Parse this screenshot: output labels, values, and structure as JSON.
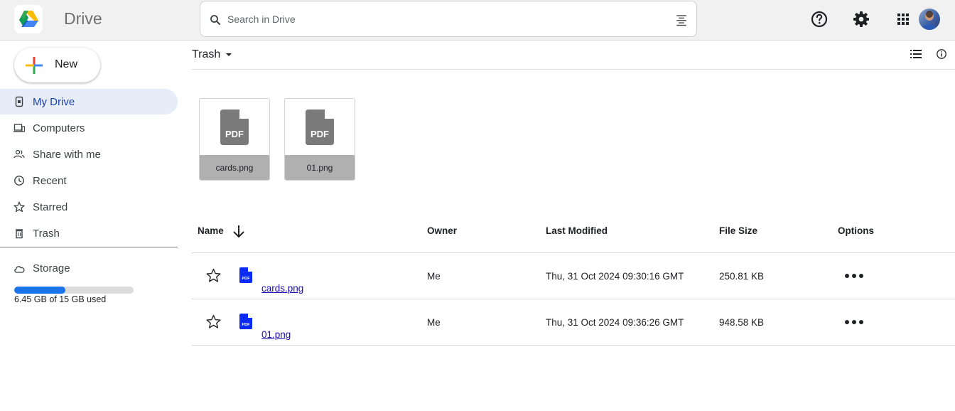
{
  "header": {
    "app_title": "Drive",
    "search_placeholder": "Search in Drive",
    "icons": [
      "drive-logo-icon",
      "search-icon",
      "filter-options-icon",
      "help-icon",
      "settings-gear-icon",
      "apps-grid-icon",
      "avatar"
    ]
  },
  "sidebar": {
    "new_label": "New",
    "items": [
      {
        "label": "My Drive",
        "icon": "my-drive-icon",
        "active": true
      },
      {
        "label": "Computers",
        "icon": "computers-icon",
        "active": false
      },
      {
        "label": "Share with me",
        "icon": "shared-people-icon",
        "active": false
      },
      {
        "label": "Recent",
        "icon": "clock-icon",
        "active": false
      },
      {
        "label": "Starred",
        "icon": "star-icon",
        "active": false
      },
      {
        "label": "Trash",
        "icon": "trash-icon",
        "active": false
      }
    ],
    "storage": {
      "label": "Storage",
      "used_text": "6.45 GB of 15 GB used",
      "used_fraction": 0.43
    }
  },
  "main": {
    "breadcrumb": "Trash",
    "cards": [
      {
        "thumb_label": "PDF",
        "name": "cards.png"
      },
      {
        "thumb_label": "PDF",
        "name": "01.png"
      }
    ],
    "table": {
      "columns": [
        "Name",
        "Owner",
        "Last Modified",
        "File Size",
        "Options"
      ],
      "rows": [
        {
          "name": "cards.png",
          "owner": "Me",
          "modified": "Thu, 31 Oct 2024 09:30:16 GMT",
          "size": "250.81 KB"
        },
        {
          "name": "01.png",
          "owner": "Me",
          "modified": "Thu, 31 Oct 2024 09:36:26 GMT",
          "size": "948.58 KB"
        }
      ]
    }
  },
  "colors": {
    "accent": "#1a73e8",
    "active_nav_bg": "#e6edf8",
    "file_icon_blue": "#0a2bf5",
    "thumb_grey": "#7a7a7a",
    "link": "#1a0dab"
  }
}
